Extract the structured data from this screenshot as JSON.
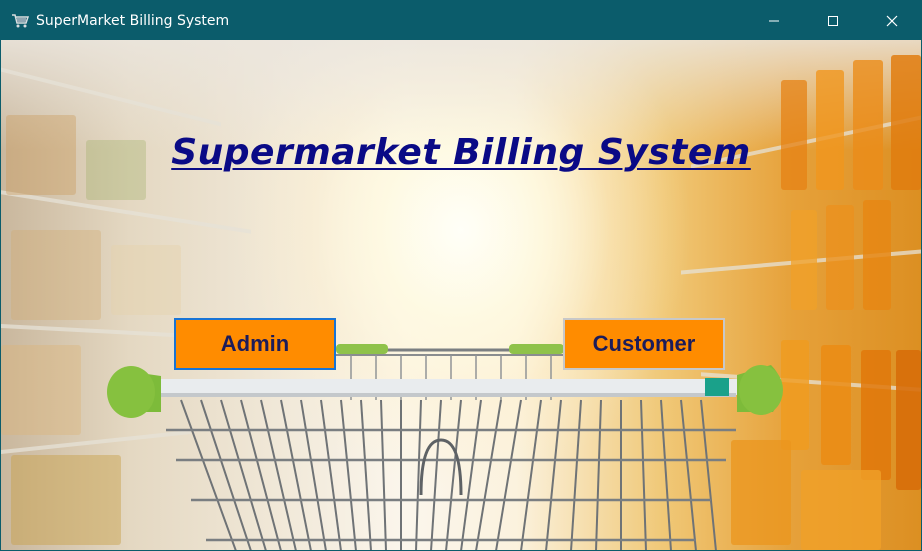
{
  "window": {
    "title": "SuperMarket Billing System",
    "app_icon": "shopping-cart-icon",
    "controls": [
      "minimize-icon",
      "maximize-icon",
      "close-icon"
    ],
    "titlebar_color": "#0b5c6b"
  },
  "main": {
    "heading": "Supermarket Billing System",
    "heading_color": "#0a0a86",
    "admin_label": "Admin",
    "customer_label": "Customer",
    "button_color": "#ff8c00"
  }
}
